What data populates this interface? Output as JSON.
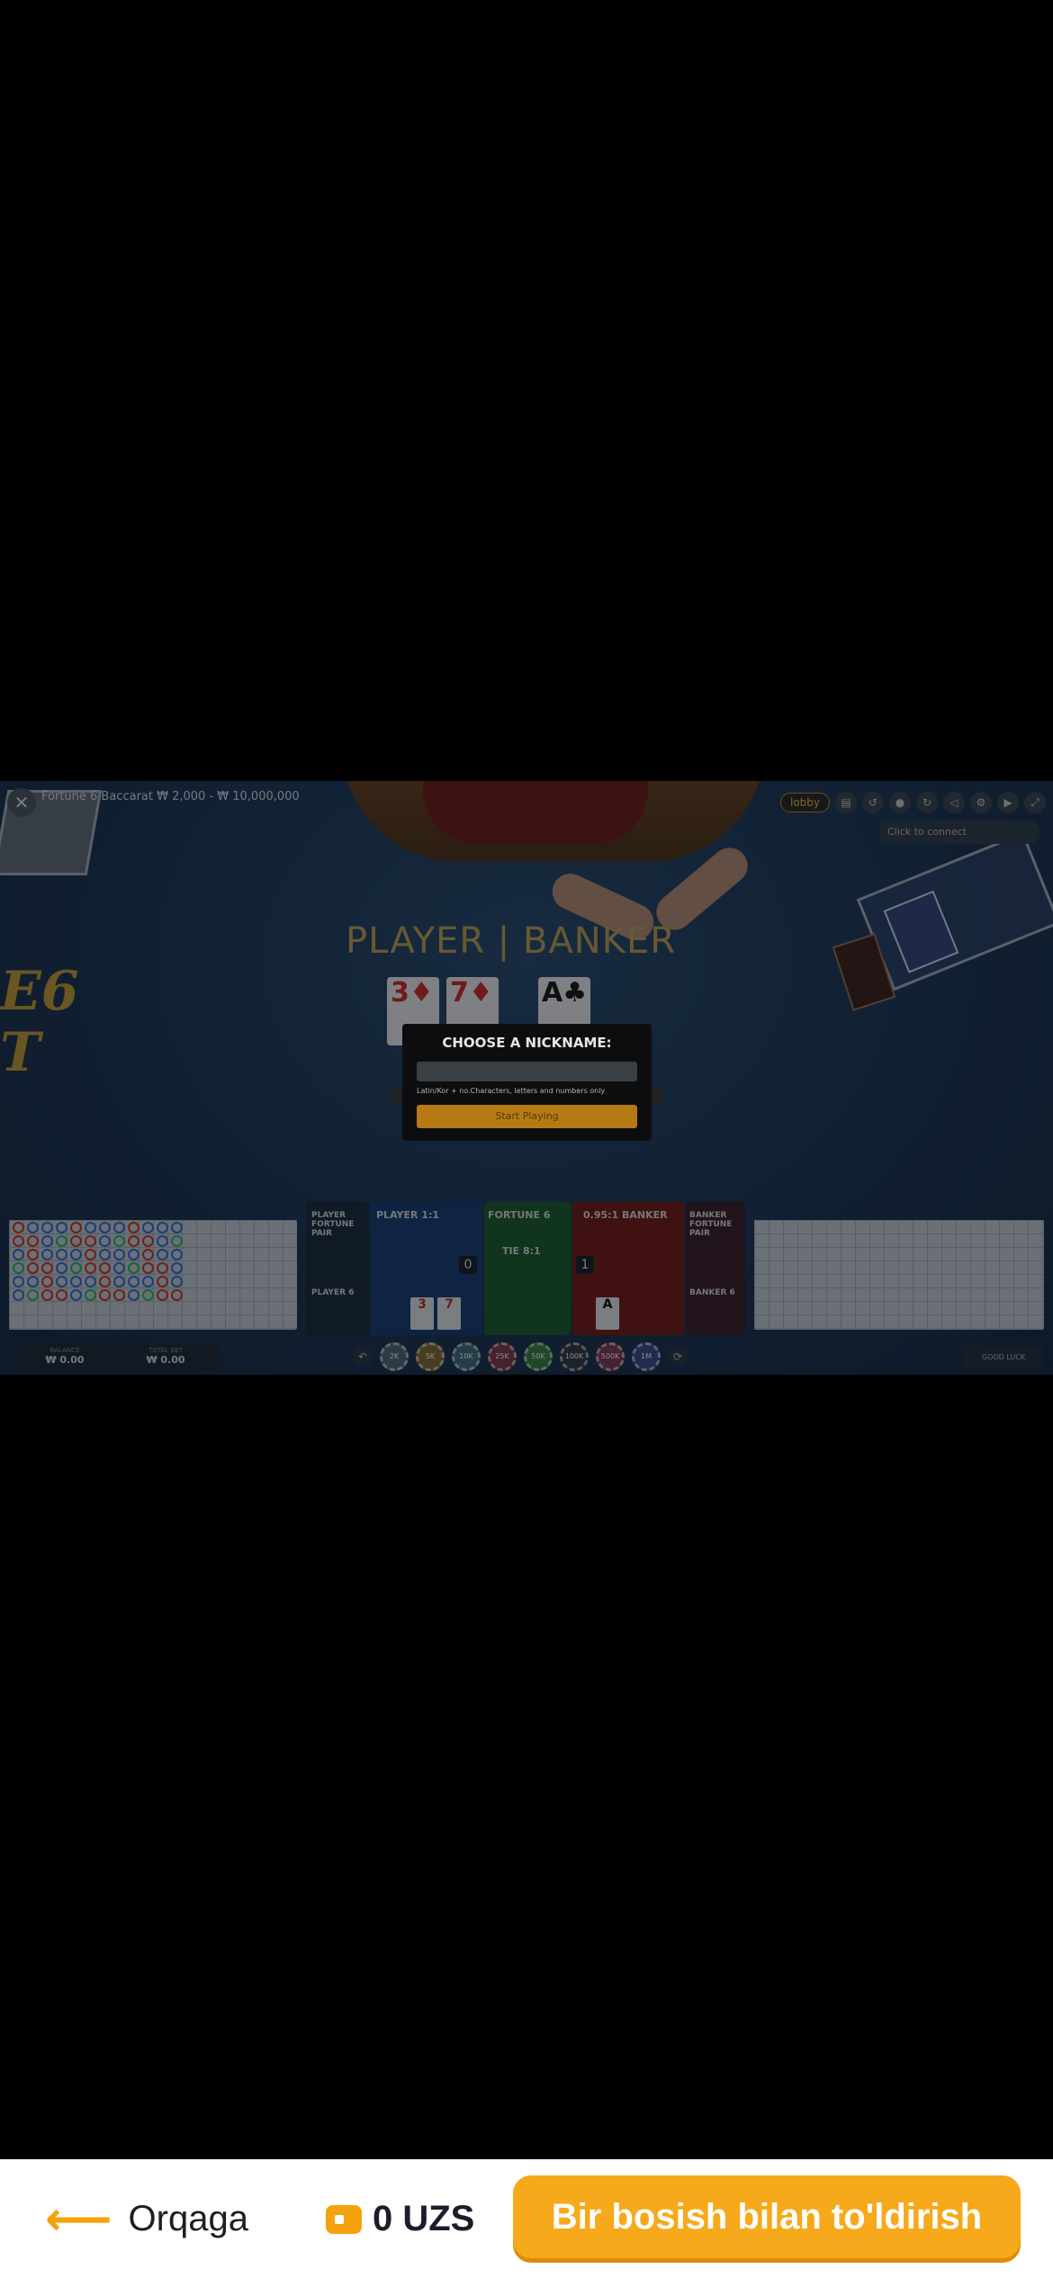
{
  "game": {
    "title": "Fortune 6 Baccarat  ₩ 2,000 - ₩ 10,000,000",
    "subtitle": "",
    "lobby_label": "lobby",
    "chat_placeholder": "Click to connect",
    "table_label_left": "PLAYER",
    "table_label_right": "BANKER",
    "side_logo": "E6\nT",
    "modal": {
      "title": "CHOOSE A NICKNAME:",
      "input_placeholder": "",
      "hint": "Latin/Kor + no.Characters, letters and numbers only",
      "button": "Start Playing"
    },
    "bet_zones": {
      "player_pair": "PLAYER FORTUNE PAIR",
      "player6": "PLAYER 6",
      "player": "PLAYER 1:1",
      "fortune6": "FORTUNE 6",
      "tie": "TIE 8:1",
      "banker": "0.95:1 BANKER",
      "banker_pair": "BANKER FORTUNE PAIR",
      "banker6": "BANKER 6",
      "player_score": "0",
      "banker_score": "1"
    },
    "balance_label": "BALANCE",
    "balance_value": "₩ 0.00",
    "total_bet_label": "TOTAL BET",
    "total_bet_value": "₩ 0.00",
    "chips": [
      "2K",
      "5K",
      "10K",
      "25K",
      "50K",
      "100K",
      "500K",
      "1M"
    ],
    "gift_label": "GOOD LUCK"
  },
  "appbar": {
    "back_label": "Orqaga",
    "wallet_amount": "0 UZS",
    "topup_label": "Bir bosish bilan to'ldirish"
  },
  "colors": {
    "accent": "#f6a91a",
    "table": "#1f3a5a"
  }
}
